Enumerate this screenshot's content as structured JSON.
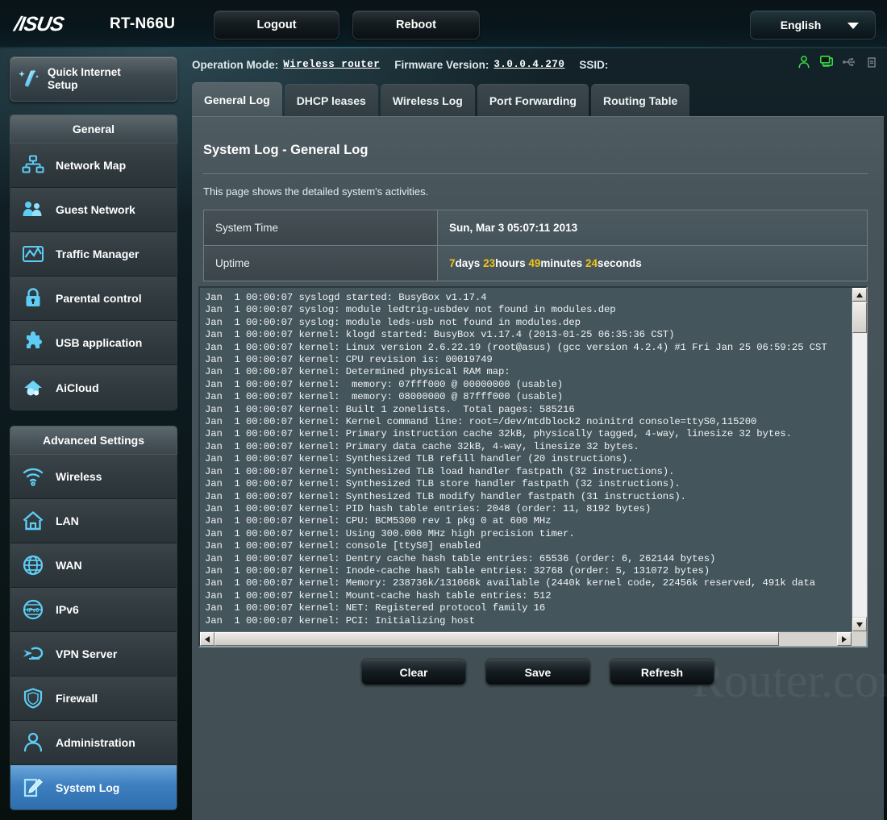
{
  "header": {
    "brand": "/ISUS",
    "model": "RT-N66U",
    "logout_label": "Logout",
    "reboot_label": "Reboot",
    "language": "English"
  },
  "infobar": {
    "operation_mode_label": "Operation Mode:",
    "operation_mode_value": "Wireless router",
    "firmware_label": "Firmware Version:",
    "firmware_value": "3.0.0.4.270",
    "ssid_label": "SSID:",
    "ssid_value": "",
    "icons": [
      {
        "name": "client-user-icon",
        "color": "#3ddc46"
      },
      {
        "name": "monitor-icon",
        "color": "#3ddc46"
      },
      {
        "name": "usb-icon",
        "color": "#6f7a7e"
      },
      {
        "name": "printer-icon",
        "color": "#6f7a7e"
      }
    ]
  },
  "sidebar": {
    "quick_setup_label": "Quick Internet\nSetup",
    "groups": [
      {
        "title": "General",
        "items": [
          {
            "label": "Network Map",
            "icon": "network-map-icon",
            "active": false
          },
          {
            "label": "Guest Network",
            "icon": "guest-network-icon",
            "active": false
          },
          {
            "label": "Traffic Manager",
            "icon": "traffic-manager-icon",
            "active": false
          },
          {
            "label": "Parental control",
            "icon": "lock-icon",
            "active": false
          },
          {
            "label": "USB application",
            "icon": "puzzle-icon",
            "active": false
          },
          {
            "label": "AiCloud",
            "icon": "cloud-icon",
            "active": false
          }
        ]
      },
      {
        "title": "Advanced Settings",
        "items": [
          {
            "label": "Wireless",
            "icon": "wifi-icon",
            "active": false
          },
          {
            "label": "LAN",
            "icon": "home-icon",
            "active": false
          },
          {
            "label": "WAN",
            "icon": "globe-icon",
            "active": false
          },
          {
            "label": "IPv6",
            "icon": "ipv6-globe-icon",
            "active": false
          },
          {
            "label": "VPN Server",
            "icon": "vpn-icon",
            "active": false
          },
          {
            "label": "Firewall",
            "icon": "shield-icon",
            "active": false
          },
          {
            "label": "Administration",
            "icon": "person-icon",
            "active": false
          },
          {
            "label": "System Log",
            "icon": "log-edit-icon",
            "active": true
          }
        ]
      }
    ]
  },
  "tabs": [
    {
      "label": "General Log",
      "active": true
    },
    {
      "label": "DHCP leases",
      "active": false
    },
    {
      "label": "Wireless Log",
      "active": false
    },
    {
      "label": "Port Forwarding",
      "active": false
    },
    {
      "label": "Routing Table",
      "active": false
    }
  ],
  "main": {
    "title": "System Log - General Log",
    "description": "This page shows the detailed system's activities.",
    "info_rows": [
      {
        "key": "System Time",
        "value": "Sun, Mar 3  05:07:11  2013"
      }
    ],
    "uptime_label": "Uptime",
    "uptime_parts": [
      {
        "num": "7",
        "unit": "days"
      },
      {
        "num": "23",
        "unit": "hours"
      },
      {
        "num": "49",
        "unit": "minutes"
      },
      {
        "num": "24",
        "unit": "seconds"
      }
    ],
    "log_text": "Jan  1 00:00:07 syslogd started: BusyBox v1.17.4\nJan  1 00:00:07 syslog: module ledtrig-usbdev not found in modules.dep\nJan  1 00:00:07 syslog: module leds-usb not found in modules.dep\nJan  1 00:00:07 kernel: klogd started: BusyBox v1.17.4 (2013-01-25 06:35:36 CST)\nJan  1 00:00:07 kernel: Linux version 2.6.22.19 (root@asus) (gcc version 4.2.4) #1 Fri Jan 25 06:59:25 CST\nJan  1 00:00:07 kernel: CPU revision is: 00019749\nJan  1 00:00:07 kernel: Determined physical RAM map:\nJan  1 00:00:07 kernel:  memory: 07fff000 @ 00000000 (usable)\nJan  1 00:00:07 kernel:  memory: 08000000 @ 87fff000 (usable)\nJan  1 00:00:07 kernel: Built 1 zonelists.  Total pages: 585216\nJan  1 00:00:07 kernel: Kernel command line: root=/dev/mtdblock2 noinitrd console=ttyS0,115200\nJan  1 00:00:07 kernel: Primary instruction cache 32kB, physically tagged, 4-way, linesize 32 bytes.\nJan  1 00:00:07 kernel: Primary data cache 32kB, 4-way, linesize 32 bytes.\nJan  1 00:00:07 kernel: Synthesized TLB refill handler (20 instructions).\nJan  1 00:00:07 kernel: Synthesized TLB load handler fastpath (32 instructions).\nJan  1 00:00:07 kernel: Synthesized TLB store handler fastpath (32 instructions).\nJan  1 00:00:07 kernel: Synthesized TLB modify handler fastpath (31 instructions).\nJan  1 00:00:07 kernel: PID hash table entries: 2048 (order: 11, 8192 bytes)\nJan  1 00:00:07 kernel: CPU: BCM5300 rev 1 pkg 0 at 600 MHz\nJan  1 00:00:07 kernel: Using 300.000 MHz high precision timer.\nJan  1 00:00:07 kernel: console [ttyS0] enabled\nJan  1 00:00:07 kernel: Dentry cache hash table entries: 65536 (order: 6, 262144 bytes)\nJan  1 00:00:07 kernel: Inode-cache hash table entries: 32768 (order: 5, 131072 bytes)\nJan  1 00:00:07 kernel: Memory: 238736k/131068k available (2440k kernel code, 22456k reserved, 491k data\nJan  1 00:00:07 kernel: Mount-cache hash table entries: 512\nJan  1 00:00:07 kernel: NET: Registered protocol family 16\nJan  1 00:00:07 kernel: PCI: Initializing host",
    "buttons": [
      {
        "label": "Clear",
        "name": "clear-button"
      },
      {
        "label": "Save",
        "name": "save-button"
      },
      {
        "label": "Refresh",
        "name": "refresh-button"
      }
    ]
  },
  "watermark": "Router.com",
  "colors": {
    "accent_blue": "#3d7fc0",
    "icon_cyan": "#5ecdf5",
    "uptime_yellow": "#f0c419",
    "status_green": "#3ddc46",
    "panel_bg": "#47555b"
  }
}
